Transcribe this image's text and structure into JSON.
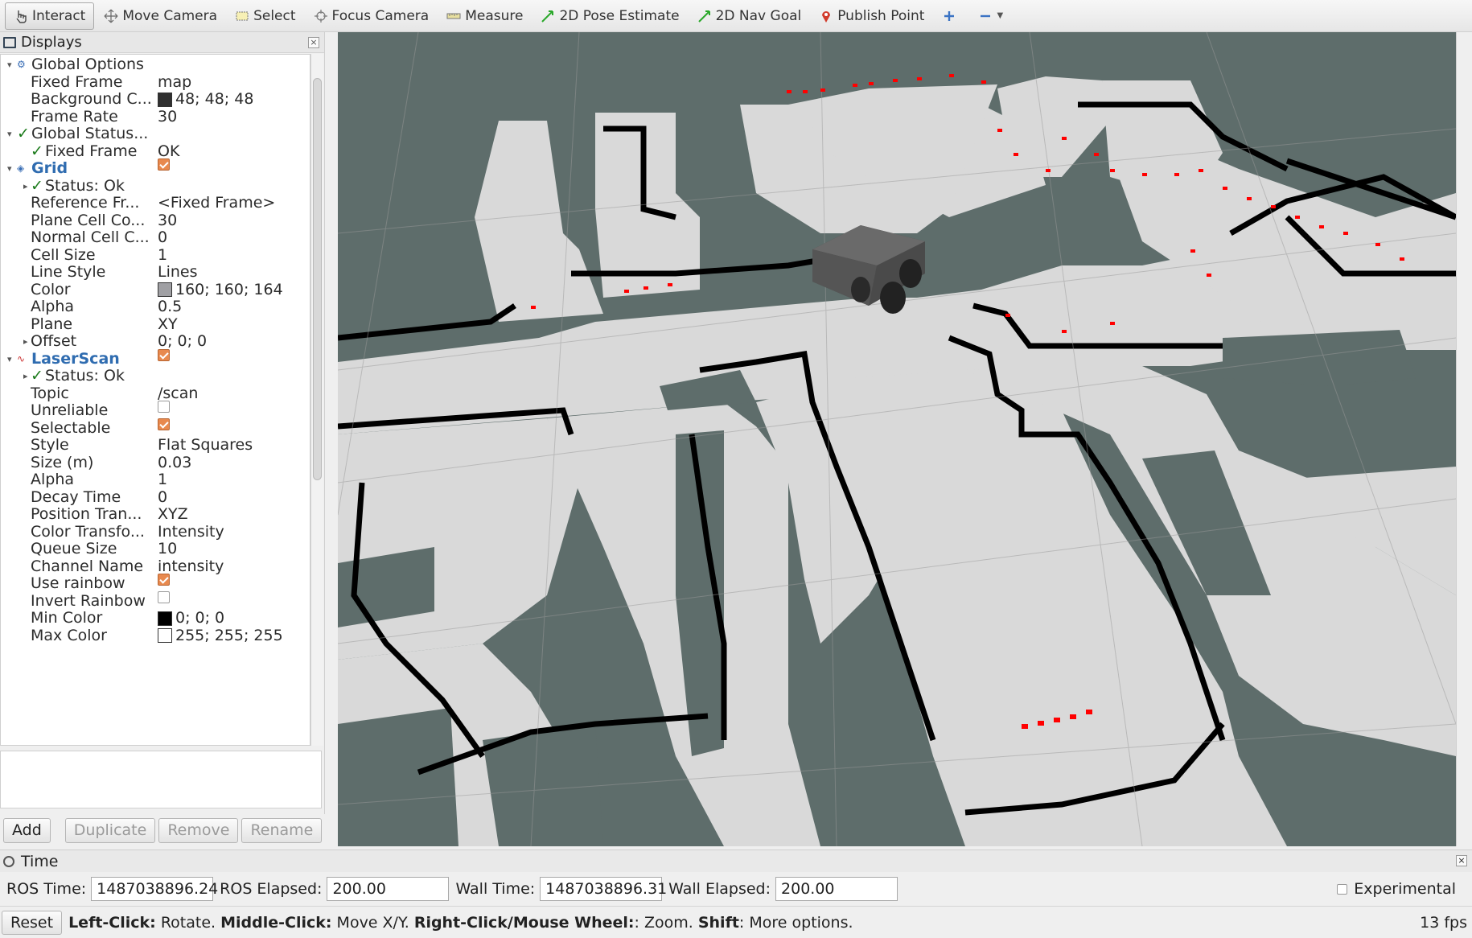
{
  "toolbar": {
    "tools": [
      {
        "label": "Interact",
        "icon": "hand-cursor-icon"
      },
      {
        "label": "Move Camera",
        "icon": "move-camera-icon"
      },
      {
        "label": "Select",
        "icon": "select-box-icon"
      },
      {
        "label": "Focus Camera",
        "icon": "focus-crosshair-icon"
      },
      {
        "label": "Measure",
        "icon": "ruler-icon"
      },
      {
        "label": "2D Pose Estimate",
        "icon": "green-arrow-icon"
      },
      {
        "label": "2D Nav Goal",
        "icon": "green-arrow-icon"
      },
      {
        "label": "Publish Point",
        "icon": "map-pin-icon"
      }
    ],
    "add_tool_icon": "plus-icon",
    "remove_tool_icon": "minus-icon"
  },
  "displays": {
    "title": "Displays",
    "rows": [
      {
        "name": "Global Options",
        "value": ""
      },
      {
        "name": "Fixed Frame",
        "value": "map"
      },
      {
        "name": "Background C...",
        "value": "48; 48; 48",
        "swatch": "#303030"
      },
      {
        "name": "Frame Rate",
        "value": "30"
      },
      {
        "name": "Global Status...",
        "value": ""
      },
      {
        "name": "Fixed Frame",
        "value": "OK"
      },
      {
        "name": "Grid",
        "value": ""
      },
      {
        "name": "Status: Ok",
        "value": ""
      },
      {
        "name": "Reference Fr...",
        "value": "<Fixed Frame>"
      },
      {
        "name": "Plane Cell Co...",
        "value": "30"
      },
      {
        "name": "Normal Cell C...",
        "value": "0"
      },
      {
        "name": "Cell Size",
        "value": "1"
      },
      {
        "name": "Line Style",
        "value": "Lines"
      },
      {
        "name": "Color",
        "value": "160; 160; 164",
        "swatch": "#a0a0a4"
      },
      {
        "name": "Alpha",
        "value": "0.5"
      },
      {
        "name": "Plane",
        "value": "XY"
      },
      {
        "name": "Offset",
        "value": "0; 0; 0"
      },
      {
        "name": "LaserScan",
        "value": ""
      },
      {
        "name": "Status: Ok",
        "value": ""
      },
      {
        "name": "Topic",
        "value": "/scan"
      },
      {
        "name": "Unreliable",
        "value": ""
      },
      {
        "name": "Selectable",
        "value": ""
      },
      {
        "name": "Style",
        "value": "Flat Squares"
      },
      {
        "name": "Size (m)",
        "value": "0.03"
      },
      {
        "name": "Alpha",
        "value": "1"
      },
      {
        "name": "Decay Time",
        "value": "0"
      },
      {
        "name": "Position Tran...",
        "value": "XYZ"
      },
      {
        "name": "Color Transfo...",
        "value": "Intensity"
      },
      {
        "name": "Queue Size",
        "value": "10"
      },
      {
        "name": "Channel Name",
        "value": "intensity"
      },
      {
        "name": "Use rainbow",
        "value": ""
      },
      {
        "name": "Invert Rainbow",
        "value": ""
      },
      {
        "name": "Min Color",
        "value": "0; 0; 0",
        "swatch": "#000000"
      },
      {
        "name": "Max Color",
        "value": "255; 255; 255",
        "swatch": "#ffffff"
      }
    ]
  },
  "buttons": {
    "add": "Add",
    "duplicate": "Duplicate",
    "remove": "Remove",
    "rename": "Rename"
  },
  "time": {
    "title": "Time",
    "ros_time_label": "ROS Time:",
    "ros_time": "1487038896.24",
    "ros_elapsed_label": "ROS Elapsed:",
    "ros_elapsed": "200.00",
    "wall_time_label": "Wall Time:",
    "wall_time": "1487038896.31",
    "wall_elapsed_label": "Wall Elapsed:",
    "wall_elapsed": "200.00",
    "experimental_label": "Experimental"
  },
  "status": {
    "reset_label": "Reset",
    "left_click_key": "Left-Click:",
    "left_click_text": "Rotate.",
    "middle_click_key": "Middle-Click:",
    "middle_click_text": "Move X/Y.",
    "right_click_key": "Right-Click/Mouse Wheel:",
    "right_click_text": ": Zoom.",
    "shift_key": "Shift",
    "shift_text": ": More options.",
    "fps": "13 fps"
  },
  "colors": {
    "background": "#303030",
    "map_free": "#d9d9d9",
    "map_unknown": "#5e6d6b",
    "map_occupied": "#000000",
    "laser_points": "#ff0000",
    "accent_checkbox": "#e8894e"
  }
}
